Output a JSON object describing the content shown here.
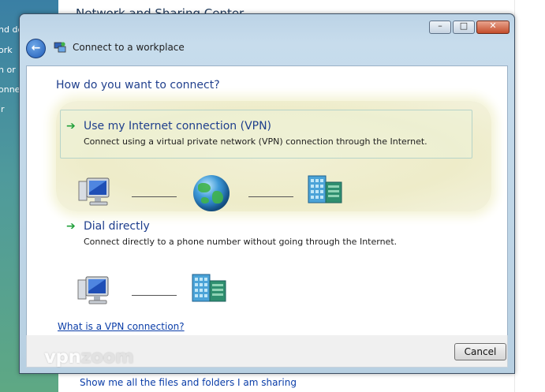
{
  "background": {
    "title": "Network and Sharing Center",
    "left_fragments": [
      "nd de",
      "ork",
      "n or",
      "onne",
      "ir"
    ],
    "bottom_link": "Show me all the files and folders I am sharing"
  },
  "dialog": {
    "title": "Connect to a workplace",
    "chrome": {
      "minimize": "–",
      "maximize": "□",
      "close": "✕"
    },
    "back_glyph": "←",
    "heading": "How do you want to connect?",
    "options": [
      {
        "title": "Use my Internet connection (VPN)",
        "description": "Connect using a virtual private network (VPN) connection through the Internet."
      },
      {
        "title": "Dial directly",
        "description": "Connect directly to a phone number without going through the Internet."
      }
    ],
    "arrow_glyph": "➔",
    "help_link": "What is a VPN connection?",
    "cancel_label": "Cancel"
  },
  "watermark": {
    "prefix": "vpn",
    "suffix": "zoom"
  },
  "colors": {
    "accent_link": "#0a3da8",
    "heading": "#1e3e8c",
    "arrow": "#21a03a",
    "highlight": "#eeecc9"
  }
}
